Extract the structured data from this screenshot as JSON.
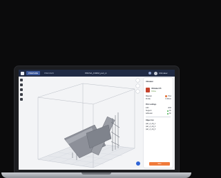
{
  "window": {
    "logo_text": "",
    "tabs": [
      "PREPARE",
      "PREVIEW"
    ],
    "title": "PRUSA_FORM_part_A",
    "user_name": "Ultimaker"
  },
  "panel": {
    "printer_name": "Ultimaker S5",
    "printer_sub": "Online",
    "rows": [
      {
        "label": "Material",
        "value": "PLA"
      },
      {
        "label": "Profile",
        "value": "0.15mm"
      },
      {
        "label": "Infill",
        "value": "20%"
      },
      {
        "label": "Support",
        "value": "On"
      },
      {
        "label": "Adhesion",
        "value": "On"
      }
    ],
    "section_settings": "Print settings",
    "section_object": "Object list",
    "objects": [
      "part_A_obj_1",
      "part_A_obj_2",
      "part_A_obj_3"
    ],
    "print_button": "Slice"
  },
  "colors": {
    "topbar": "#1f2a44",
    "accent": "#2f64d6",
    "print_button": "#f07a3a",
    "printer_thumb": "#c6422c"
  },
  "icons": [
    "move-icon",
    "scale-icon",
    "rotate-icon",
    "mirror-icon",
    "support-icon"
  ]
}
